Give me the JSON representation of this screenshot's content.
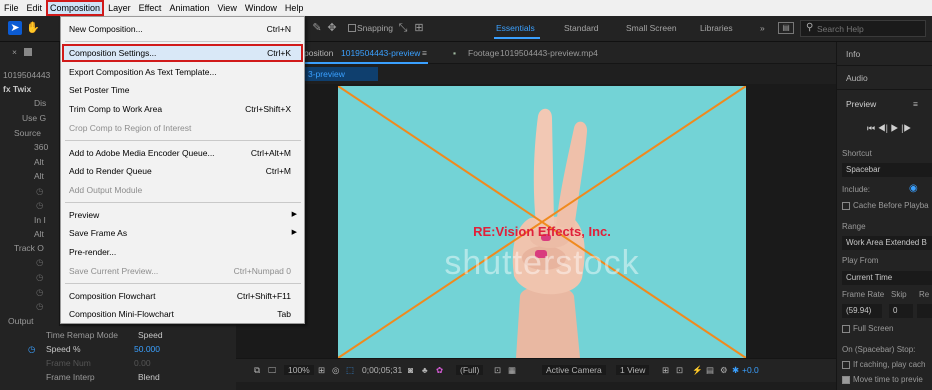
{
  "menubar": {
    "items": [
      "File",
      "Edit",
      "Composition",
      "Layer",
      "Effect",
      "Animation",
      "View",
      "Window",
      "Help"
    ],
    "active_index": 2
  },
  "toolbar": {
    "snapping_label": "Snapping",
    "workspaces": [
      "Essentials",
      "Standard",
      "Small Screen",
      "Libraries"
    ],
    "active_workspace": "Essentials",
    "overflow": "»",
    "search_placeholder": "Search Help"
  },
  "composition_menu": {
    "items": [
      {
        "label": "New Composition...",
        "shortcut": "Ctrl+N",
        "enabled": true
      },
      {
        "label": "Composition Settings...",
        "shortcut": "Ctrl+K",
        "enabled": true,
        "highlighted": true
      },
      {
        "label": "Export Composition As Text Template...",
        "shortcut": "",
        "enabled": true
      },
      {
        "label": "Set Poster Time",
        "shortcut": "",
        "enabled": true
      },
      {
        "label": "Trim Comp to Work Area",
        "shortcut": "Ctrl+Shift+X",
        "enabled": true
      },
      {
        "label": "Crop Comp to Region of Interest",
        "shortcut": "",
        "enabled": false
      },
      {
        "label": "Add to Adobe Media Encoder Queue...",
        "shortcut": "Ctrl+Alt+M",
        "enabled": true
      },
      {
        "label": "Add to Render Queue",
        "shortcut": "Ctrl+M",
        "enabled": true
      },
      {
        "label": "Add Output Module",
        "shortcut": "",
        "enabled": false
      },
      {
        "label": "Preview",
        "shortcut": "",
        "enabled": true,
        "submenu": true
      },
      {
        "label": "Save Frame As",
        "shortcut": "",
        "enabled": true,
        "submenu": true
      },
      {
        "label": "Pre-render...",
        "shortcut": "",
        "enabled": true
      },
      {
        "label": "Save Current Preview...",
        "shortcut": "Ctrl+Numpad 0",
        "enabled": false
      },
      {
        "label": "Composition Flowchart",
        "shortcut": "Ctrl+Shift+F11",
        "enabled": true
      },
      {
        "label": "Composition Mini-Flowchart",
        "shortcut": "Tab",
        "enabled": true
      }
    ]
  },
  "left_panel": {
    "close": "×",
    "layer_name": "1019504443",
    "rows": [
      "fx Twix",
      "Dis",
      "Use G",
      "Source",
      "360",
      "Alt",
      "Alt",
      "",
      "",
      "In I",
      "Alt",
      "Track O",
      "",
      "",
      "",
      "",
      "Output"
    ],
    "timeline_rows": [
      {
        "label": "Time Remap Mode",
        "value": "Speed"
      },
      {
        "label": "Speed %",
        "value": "50.000"
      },
      {
        "label": "Frame Num",
        "value": "0.00"
      },
      {
        "label": "Frame Interp",
        "value": "Blend"
      }
    ]
  },
  "viewer": {
    "comp_tab_label": "position",
    "comp_name": "1019504443-preview",
    "footage_tab_label": "Footage",
    "footage_name": "1019504443-preview.mp4",
    "breadcrumb": "3-preview",
    "watermark": "shutterstock",
    "overlay_text": "RE:Vision Effects, Inc.",
    "bottom": {
      "zoom": "100%",
      "timecode": "0;00;05;31",
      "resolution": "(Full)",
      "camera": "Active Camera",
      "views": "1 View",
      "exposure": "+0.0"
    }
  },
  "right_panel": {
    "info": "Info",
    "audio": "Audio",
    "preview": "Preview",
    "shortcut_label": "Shortcut",
    "shortcut_value": "Spacebar",
    "include_label": "Include:",
    "cache_label": "Cache Before Playba",
    "range_label": "Range",
    "range_value": "Work Area Extended B",
    "play_from_label": "Play From",
    "play_from_value": "Current Time",
    "frame_rate_label": "Frame Rate",
    "skip_label": "Skip",
    "res_label": "Re",
    "frame_rate_value": "(59.94)",
    "skip_value": "0",
    "full_screen_label": "Full Screen",
    "on_stop_label": "On (Spacebar) Stop:",
    "if_caching_label": "If caching, play cach",
    "move_time_label": "Move time to previe"
  },
  "colors": {
    "accent": "#3aa0ff",
    "highlight_outline": "#d11a1a",
    "frame_bg": "#73d3d6",
    "overlay_text": "#e0203a",
    "x_lines": "#f08a1e"
  }
}
